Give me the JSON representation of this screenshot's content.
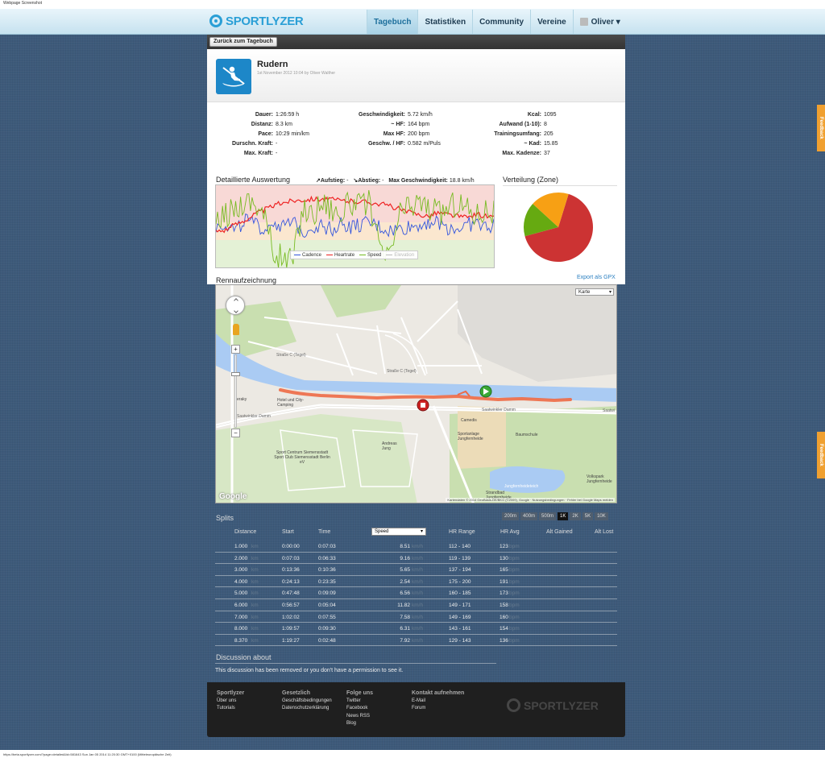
{
  "browser": {
    "header_text": "Webpage Screenshot",
    "footer_text": "https://beta.sportlyzer.com/?page=detailed&id=581643 Sun Jan 05 2014 11:20:30 GMT+0100 (Mitteleuropäische Zeit)"
  },
  "brand": {
    "name": "SPORTLYZER",
    "color": "#2a9fd6"
  },
  "nav": {
    "items": [
      "Tagebuch",
      "Statistiken",
      "Community",
      "Vereine"
    ],
    "active": "Tagebuch",
    "user": "Oliver ▾"
  },
  "back_button": "Zurück zum Tagebuch",
  "activity": {
    "icon": "rowing-icon",
    "title": "Rudern",
    "subtitle": "1st November 2012 10:04 by Oliver Walther"
  },
  "stats": {
    "col1": [
      {
        "label": "Dauer:",
        "value": "1:26:59 h"
      },
      {
        "label": "Distanz:",
        "value": "8.3 km"
      },
      {
        "label": "Pace:",
        "value": "10:29 min/km"
      },
      {
        "label": "Durschn. Kraft:",
        "value": "-"
      },
      {
        "label": "Max. Kraft:",
        "value": "-"
      }
    ],
    "col2": [
      {
        "label": "Geschwindigkeit:",
        "value": "5.72 km/h"
      },
      {
        "label": "~ HF:",
        "value": "164 bpm"
      },
      {
        "label": "Max HF:",
        "value": "200 bpm"
      },
      {
        "label": "Geschw. / HF:",
        "value": "0.582 m/Puls"
      }
    ],
    "col3": [
      {
        "label": "Kcal:",
        "value": "1095"
      },
      {
        "label": "Aufwand (1-10):",
        "value": "8"
      },
      {
        "label": "Trainingsumfang:",
        "value": "205"
      },
      {
        "label": "~ Kad:",
        "value": "15.85"
      },
      {
        "label": "Max. Kadenze:",
        "value": "37"
      }
    ]
  },
  "detail": {
    "title": "Detaillierte Auswertung",
    "ascent_label": "↗Aufstieg:",
    "ascent_value": "-",
    "descent_label": "↘Abstieg:",
    "descent_value": "-",
    "maxspeed_label": "Max Geschwindigkeit:",
    "maxspeed_value": "18.8 km/h",
    "legend": [
      {
        "name": "Cadence",
        "color": "#3355dd",
        "dim": false
      },
      {
        "name": "Heartrate",
        "color": "#ee2222",
        "dim": false
      },
      {
        "name": "Speed",
        "color": "#77bb22",
        "dim": false
      },
      {
        "name": "Elevation",
        "color": "#bbbbbb",
        "dim": true
      }
    ],
    "zones": [
      {
        "color": "#f8d9d6"
      },
      {
        "color": "#fbe7cf"
      },
      {
        "color": "#e4f1d6"
      }
    ]
  },
  "chart_data": {
    "type": "line",
    "series": [
      {
        "name": "Cadence",
        "values": [
          20,
          22,
          18,
          24,
          21,
          19,
          23,
          20,
          22,
          18,
          20,
          21,
          19,
          22,
          20,
          21,
          22,
          20,
          18,
          19,
          20,
          21,
          23,
          22,
          20,
          19,
          21,
          22,
          20,
          21
        ]
      },
      {
        "name": "Heartrate",
        "values": [
          150,
          152,
          158,
          163,
          170,
          175,
          180,
          184,
          186,
          187,
          188,
          188,
          187,
          186,
          185,
          185,
          184,
          182,
          180,
          176,
          172,
          170,
          168,
          172,
          170,
          168,
          166,
          170,
          168,
          165
        ]
      },
      {
        "name": "Speed",
        "values": [
          6,
          8,
          9,
          10,
          10,
          8,
          2,
          1,
          1,
          9,
          8,
          10,
          9,
          8,
          10,
          9,
          10,
          2,
          1,
          8,
          9,
          10,
          9,
          8,
          9,
          10,
          9,
          8,
          9,
          8
        ]
      }
    ]
  },
  "distribution": {
    "title": "Verteilung (Zone)",
    "slices": [
      {
        "value": 66,
        "color": "#cc3333"
      },
      {
        "value": 18,
        "color": "#f7a014"
      },
      {
        "value": 16,
        "color": "#66aa11"
      }
    ]
  },
  "race": {
    "title": "Rennaufzeichnung",
    "export": "Export als GPX",
    "map_type": "Karte",
    "labels": [
      {
        "text": "Saatwinkler Damm",
        "cls": "road"
      },
      {
        "text": "Saatwinkler Damm",
        "cls": "road"
      },
      {
        "text": "Saatwi",
        "cls": "road"
      },
      {
        "text": "Hotel und City-Camping",
        "cls": ""
      },
      {
        "text": "Sport Centrum Siemensstadt Sport Club Siemensstadt Berlin eV",
        "cls": ""
      },
      {
        "text": "Andreas Jung",
        "cls": ""
      },
      {
        "text": "Camedis",
        "cls": ""
      },
      {
        "text": "Sportanlage Jungfernheide",
        "cls": ""
      },
      {
        "text": "Baumschule",
        "cls": ""
      },
      {
        "text": "Strandbad Jungfernheide",
        "cls": ""
      },
      {
        "text": "Jungfernheideteich",
        "cls": ""
      },
      {
        "text": "Volkspark Jungfernheide",
        "cls": ""
      },
      {
        "text": "Straße C (Tegel)",
        "cls": "road"
      },
      {
        "text": "Straße C (Tegel)",
        "cls": "road"
      },
      {
        "text": "eraky",
        "cls": ""
      }
    ],
    "attribution": "Kartendaten © 2014 GeoBasis-DE/BKG (©2009), Google · Nutzungsbedingungen · Fehler bei Google Maps melden",
    "google": "Google"
  },
  "splits": {
    "title": "Splits",
    "buttons": [
      "200m",
      "400m",
      "500m",
      "1K",
      "2K",
      "5K",
      "10K"
    ],
    "active": "1K",
    "headers": {
      "distance": "Distance",
      "start": "Start",
      "time": "Time",
      "metric": "Speed",
      "hr_range": "HR Range",
      "hr_avg": "HR Avg",
      "alt_gained": "Alt Gained",
      "alt_lost": "Alt Lost"
    },
    "rows": [
      {
        "d": "1.000",
        "s": "0:00:00",
        "t": "0:07:03",
        "v": "8.51",
        "r": "112 - 140",
        "a": "123"
      },
      {
        "d": "2.000",
        "s": "0:07:03",
        "t": "0:06:33",
        "v": "9.16",
        "r": "119 - 139",
        "a": "130"
      },
      {
        "d": "3.000",
        "s": "0:13:36",
        "t": "0:10:36",
        "v": "5.65",
        "r": "137 - 194",
        "a": "165"
      },
      {
        "d": "4.000",
        "s": "0:24:13",
        "t": "0:23:35",
        "v": "2.54",
        "r": "175 - 200",
        "a": "191"
      },
      {
        "d": "5.000",
        "s": "0:47:48",
        "t": "0:09:09",
        "v": "6.56",
        "r": "160 - 185",
        "a": "173"
      },
      {
        "d": "6.000",
        "s": "0:56:57",
        "t": "0:05:04",
        "v": "11.82",
        "r": "149 - 171",
        "a": "158"
      },
      {
        "d": "7.000",
        "s": "1:02:02",
        "t": "0:07:55",
        "v": "7.58",
        "r": "149 - 169",
        "a": "160"
      },
      {
        "d": "8.000",
        "s": "1:09:57",
        "t": "0:09:30",
        "v": "6.31",
        "r": "143 - 161",
        "a": "154"
      },
      {
        "d": "8.370",
        "s": "1:19:27",
        "t": "0:02:48",
        "v": "7.92",
        "r": "129 - 143",
        "a": "136"
      }
    ],
    "unit_dist": "km",
    "unit_speed": "km/h",
    "unit_hr": "bpm"
  },
  "discussion": {
    "title": "Discussion about",
    "text": "This discussion has been removed or you don't have a permission to see it."
  },
  "footer": {
    "columns": [
      {
        "heading": "Sportlyzer",
        "links": [
          "Über uns",
          "Tutorials"
        ]
      },
      {
        "heading": "Gesetzlich",
        "links": [
          "Geschäftsbedingungen",
          "Datenschutzerklärung"
        ]
      },
      {
        "heading": "Folge uns",
        "links": [
          "Twitter",
          "Facebook",
          "News RSS",
          "Blog"
        ]
      },
      {
        "heading": "Kontakt aufnehmen",
        "links": [
          "E-Mail",
          "Forum"
        ]
      }
    ],
    "logo": "SPORTLYZER"
  },
  "feedback": "Feedback"
}
